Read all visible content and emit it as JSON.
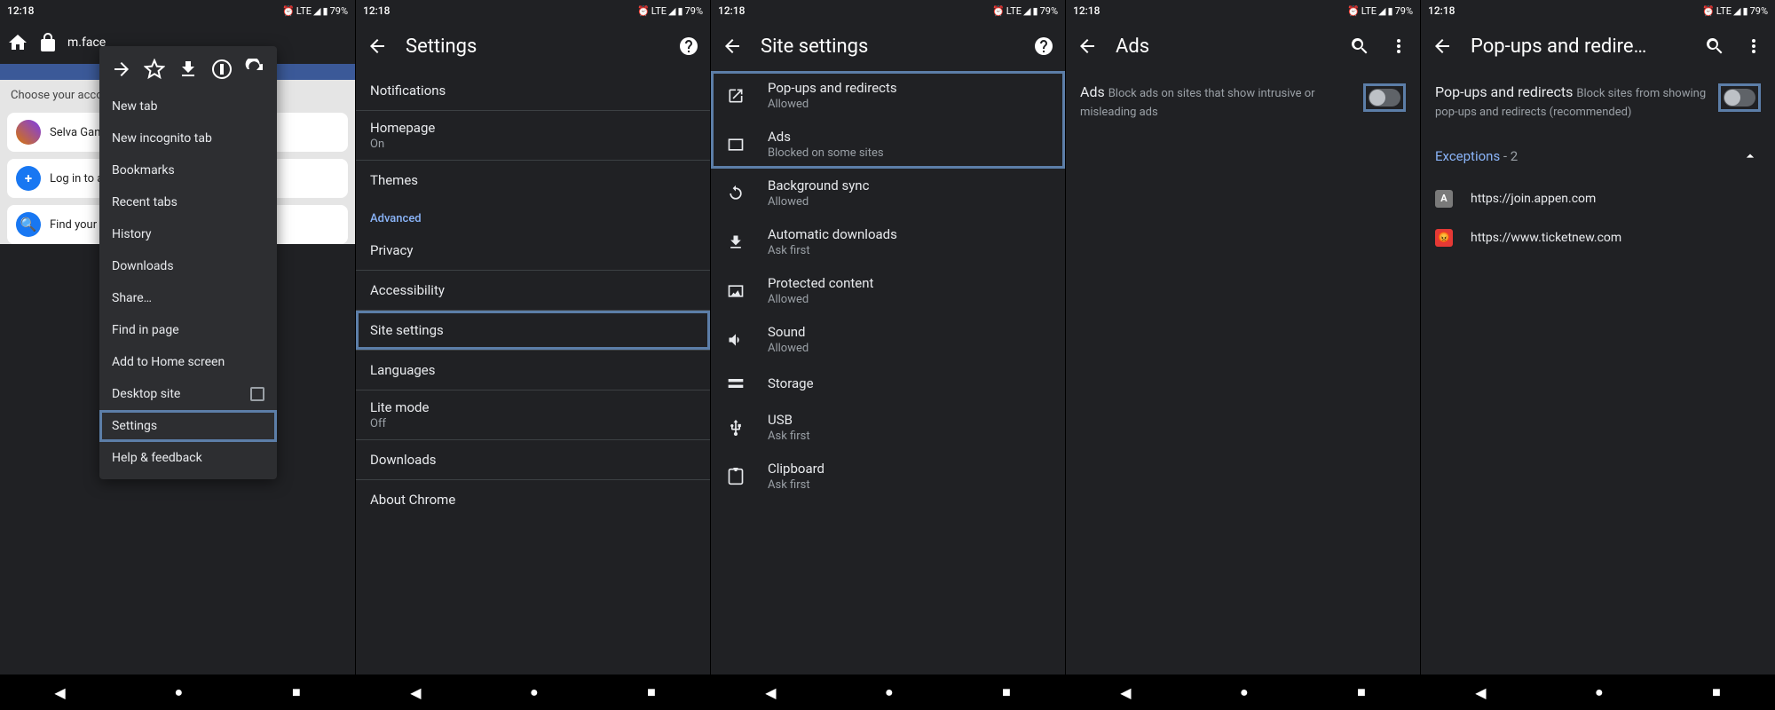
{
  "status": {
    "time": "12:18",
    "net": "LTE",
    "battery": "79%"
  },
  "screen1": {
    "url": "m.face",
    "fb_choose": "Choose your account",
    "acct_name": "Selva Gan",
    "login_another": "Log in to a",
    "find_account": "Find your",
    "menu": {
      "new_tab": "New tab",
      "incognito": "New incognito tab",
      "bookmarks": "Bookmarks",
      "recent_tabs": "Recent tabs",
      "history": "History",
      "downloads": "Downloads",
      "share": "Share…",
      "find": "Find in page",
      "add_home": "Add to Home screen",
      "desktop": "Desktop site",
      "settings": "Settings",
      "help": "Help & feedback"
    }
  },
  "screen2": {
    "title": "Settings",
    "items": {
      "notifications": "Notifications",
      "homepage": "Homepage",
      "homepage_sub": "On",
      "themes": "Themes",
      "advanced_label": "Advanced",
      "privacy": "Privacy",
      "accessibility": "Accessibility",
      "site_settings": "Site settings",
      "languages": "Languages",
      "lite_mode": "Lite mode",
      "lite_mode_sub": "Off",
      "downloads": "Downloads",
      "about": "About Chrome"
    }
  },
  "screen3": {
    "title": "Site settings",
    "items": [
      {
        "title": "Pop-ups and redirects",
        "sub": "Allowed",
        "icon": "popup"
      },
      {
        "title": "Ads",
        "sub": "Blocked on some sites",
        "icon": "ads"
      },
      {
        "title": "Background sync",
        "sub": "Allowed",
        "icon": "sync"
      },
      {
        "title": "Automatic downloads",
        "sub": "Ask first",
        "icon": "download"
      },
      {
        "title": "Protected content",
        "sub": "Allowed",
        "icon": "protected"
      },
      {
        "title": "Sound",
        "sub": "Allowed",
        "icon": "sound"
      },
      {
        "title": "Storage",
        "sub": "",
        "icon": "storage"
      },
      {
        "title": "USB",
        "sub": "Ask first",
        "icon": "usb"
      },
      {
        "title": "Clipboard",
        "sub": "Ask first",
        "icon": "clipboard"
      }
    ]
  },
  "screen4": {
    "title": "Ads",
    "heading": "Ads",
    "desc": "Block ads on sites that show intrusive or misleading ads"
  },
  "screen5": {
    "title": "Pop-ups and redire…",
    "heading": "Pop-ups and redirects",
    "desc": "Block sites from showing pop-ups and redirects (recommended)",
    "exceptions_label": "Exceptions",
    "exceptions_count": "- 2",
    "exceptions": [
      {
        "url": "https://join.appen.com",
        "color": "#7a7a7a",
        "letter": "A"
      },
      {
        "url": "https://www.ticketnew.com",
        "color": "#e53935",
        "letter": ""
      }
    ]
  }
}
